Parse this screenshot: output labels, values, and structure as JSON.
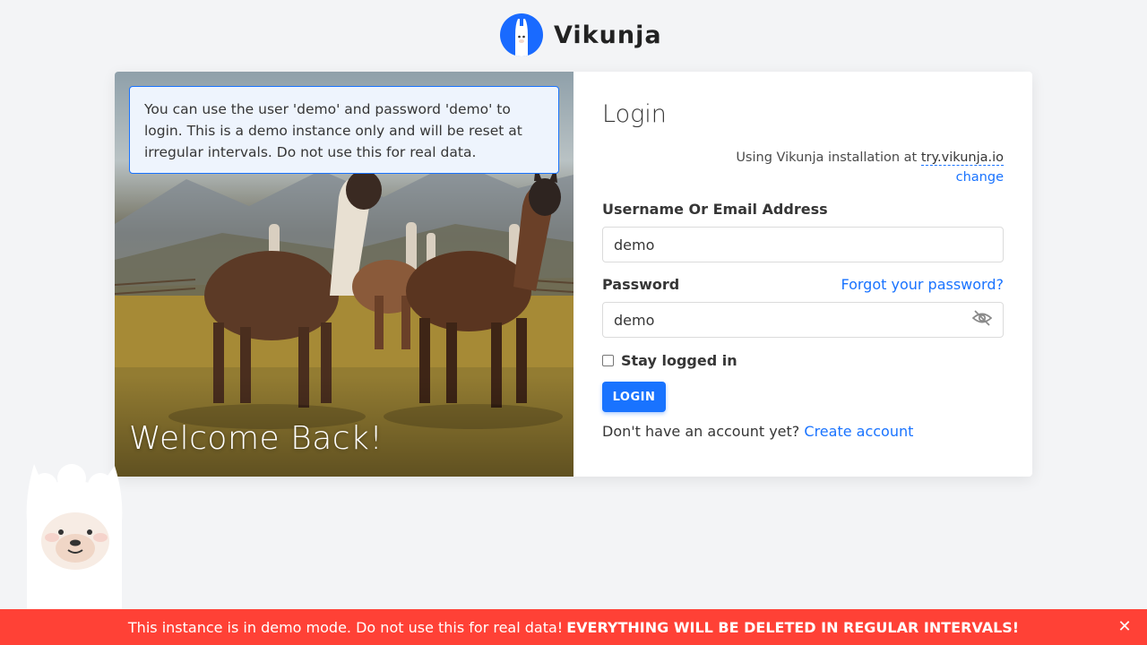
{
  "app": {
    "name": "Vikunja"
  },
  "demo_notice": "You can use the user 'demo' and password 'demo' to login. This is a demo instance only and will be reset at irregular intervals. Do not use this for real data.",
  "hero": {
    "welcome_text": "Welcome Back!"
  },
  "login": {
    "title": "Login",
    "install_prefix": "Using Vikunja installation at",
    "install_url": "try.vikunja.io",
    "change_label": "change",
    "username_label": "Username Or Email Address",
    "username_value": "demo",
    "password_label": "Password",
    "forgot_label": "Forgot your password?",
    "password_value": "demo",
    "stay_logged_in_label": "Stay logged in",
    "login_button": "LOGIN",
    "no_account_text": "Don't have an account yet?",
    "create_account_label": "Create account"
  },
  "banner": {
    "text": "This instance is in demo mode. Do not use this for real data!",
    "strong_text": "EVERYTHING WILL BE DELETED IN REGULAR INTERVALS!",
    "close_icon": "close-icon"
  },
  "colors": {
    "primary": "#1973ff",
    "banner": "#ff4136",
    "background": "#f3f4f6"
  }
}
